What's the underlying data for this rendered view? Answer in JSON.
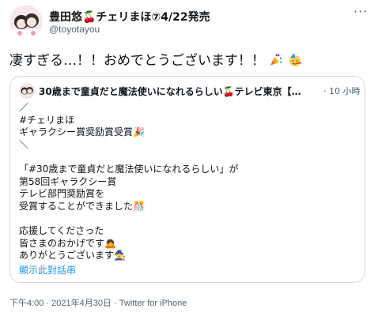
{
  "author": {
    "display_name": "豊田悠🍒チェリまほ⑦4/22発売",
    "username": "@toyotayou",
    "avatar_icon": "author-avatar-illustration"
  },
  "tweet": {
    "text": "凄すぎる…！！おめでとうございます！！",
    "emojis": [
      "party-popper-icon",
      "partying-face-icon"
    ]
  },
  "quoted_tweet": {
    "author_name": "30歳まで童貞だと魔法使いになれるらしい🍒テレビ東京【…",
    "time": "· 10 小時",
    "lines": [
      "／",
      "#チェリまほ",
      "ギャラクシー賞奨励賞受賞🎉",
      "＼",
      "",
      "「#30歳まで童貞だと魔法使いになれるらしい」が",
      "第58回ギャラクシー賞",
      "テレビ部門奨励賞を",
      "受賞することができました🎊",
      "",
      "応援してくださった",
      "皆さまのおかげです🙇",
      "ありがとうございます🧙"
    ],
    "show_thread": "顯示此對話串"
  },
  "meta": {
    "timestamp": "下午4:00 · 2021年4月30日 · Twitter for iPhone"
  },
  "colors": {
    "text": "#0f1419",
    "secondary": "#536471",
    "link": "#1d9bf0",
    "border": "#cfd9de"
  }
}
